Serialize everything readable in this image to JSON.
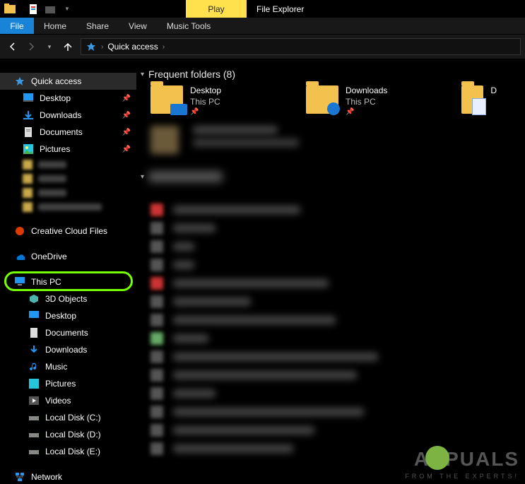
{
  "title_tabs": {
    "play": "Play",
    "app": "File Explorer"
  },
  "menu": {
    "file": "File",
    "home": "Home",
    "share": "Share",
    "view": "View",
    "music_tools": "Music Tools"
  },
  "nav": {
    "back": "←",
    "forward": "→",
    "up": "↑"
  },
  "address": {
    "root": "Quick access"
  },
  "sidebar": {
    "quick_access": "Quick access",
    "items_pinned": [
      {
        "label": "Desktop"
      },
      {
        "label": "Downloads"
      },
      {
        "label": "Documents"
      },
      {
        "label": "Pictures"
      }
    ],
    "creative_cloud": "Creative Cloud Files",
    "onedrive": "OneDrive",
    "this_pc": "This PC",
    "pc_children": [
      {
        "label": "3D Objects"
      },
      {
        "label": "Desktop"
      },
      {
        "label": "Documents"
      },
      {
        "label": "Downloads"
      },
      {
        "label": "Music"
      },
      {
        "label": "Pictures"
      },
      {
        "label": "Videos"
      },
      {
        "label": "Local Disk (C:)"
      },
      {
        "label": "Local Disk (D:)"
      },
      {
        "label": "Local Disk (E:)"
      }
    ],
    "network": "Network"
  },
  "content": {
    "section1": {
      "title": "Frequent folders",
      "count": "(8)"
    },
    "folders": [
      {
        "name": "Desktop",
        "location": "This PC",
        "kind": "desktop"
      },
      {
        "name": "Downloads",
        "location": "This PC",
        "kind": "downloads"
      },
      {
        "name": "D",
        "location": "",
        "kind": "docs"
      }
    ]
  },
  "watermark": {
    "brand_left": "A",
    "brand_right": "PUALS",
    "sub": "FROM THE EXPERTS!"
  }
}
